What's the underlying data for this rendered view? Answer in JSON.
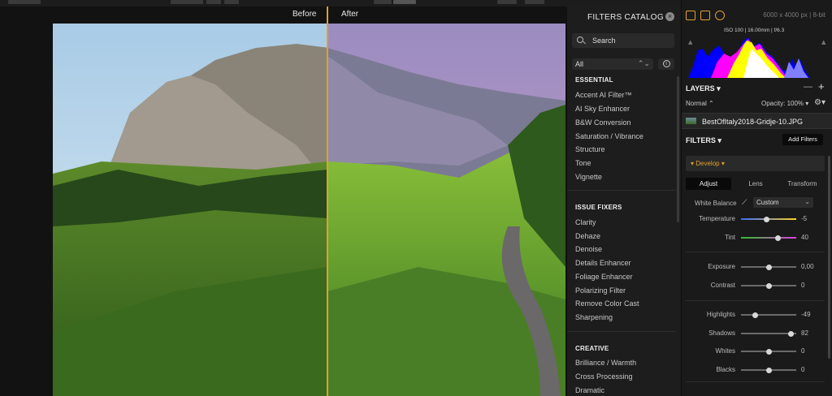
{
  "compare": {
    "before": "Before",
    "after": "After"
  },
  "catalog": {
    "title": "FILTERS CATALOG",
    "close": "×",
    "search_placeholder": "Search",
    "dropdown": "All",
    "dropdown_arrow": "⌃⌄",
    "info": "i",
    "sections": [
      {
        "title": "ESSENTIAL",
        "items": [
          "Accent AI Filter™",
          "AI Sky Enhancer",
          "B&W Conversion",
          "Saturation / Vibrance",
          "Structure",
          "Tone",
          "Vignette"
        ]
      },
      {
        "title": "ISSUE FIXERS",
        "items": [
          "Clarity",
          "Dehaze",
          "Denoise",
          "Details Enhancer",
          "Foliage Enhancer",
          "Polarizing Filter",
          "Remove Color Cast",
          "Sharpening"
        ]
      },
      {
        "title": "CREATIVE",
        "items": [
          "Brilliance / Warmth",
          "Cross Processing",
          "Dramatic"
        ]
      }
    ]
  },
  "info": {
    "dims": "6000 x 4000 px  |  8-bit",
    "exif": "ISO 100  |  16.00mm  |  f/6.3"
  },
  "layers": {
    "title": "LAYERS ▾",
    "minus": "—",
    "plus": "+",
    "blend": "Normal ⌃",
    "opacity": "Opacity: 100% ▾",
    "gear": "⚙▾",
    "filename": "BestOfItaly2018-Gridje-10.JPG"
  },
  "filters": {
    "title": "FILTERS ▾",
    "add_label": "Add Filters",
    "develop_label": "▾ Develop ▾",
    "tabs": [
      "Adjust",
      "Lens",
      "Transform"
    ],
    "white_balance": {
      "label": "White Balance",
      "picker": "⟋",
      "value": "Custom",
      "arrow": "⌄"
    },
    "sliders": [
      {
        "name": "Temperature",
        "value": "-5",
        "pos": 0.46,
        "track": "temp"
      },
      {
        "name": "Tint",
        "value": "40",
        "pos": 0.67,
        "track": "tint"
      },
      {
        "name": "Exposure",
        "value": "0,00",
        "pos": 0.5,
        "track": "plain"
      },
      {
        "name": "Contrast",
        "value": "0",
        "pos": 0.5,
        "track": "plain"
      },
      {
        "name": "Highlights",
        "value": "-49",
        "pos": 0.26,
        "track": "plain"
      },
      {
        "name": "Shadows",
        "value": "82",
        "pos": 0.91,
        "track": "plain"
      },
      {
        "name": "Whites",
        "value": "0",
        "pos": 0.5,
        "track": "plain"
      },
      {
        "name": "Blacks",
        "value": "0",
        "pos": 0.5,
        "track": "plain"
      }
    ]
  },
  "colors": {
    "accent": "#e0a030"
  }
}
